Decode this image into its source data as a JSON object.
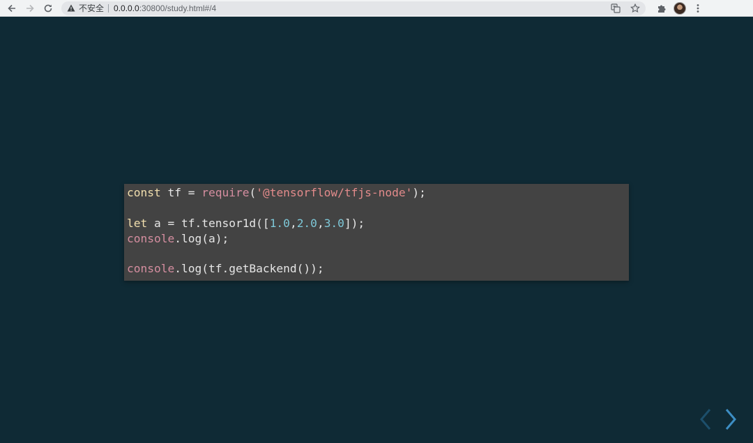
{
  "browser": {
    "insecure_label": "不安全",
    "url_host": "0.0.0.0",
    "url_rest": ":30800/study.html#/4"
  },
  "code": {
    "lines": [
      [
        {
          "t": "const",
          "c": "kw"
        },
        {
          "t": " tf = ",
          "c": "plain"
        },
        {
          "t": "require",
          "c": "builtin"
        },
        {
          "t": "(",
          "c": "plain"
        },
        {
          "t": "'@tensorflow/tfjs-node'",
          "c": "str"
        },
        {
          "t": ");",
          "c": "plain"
        }
      ],
      [],
      [
        {
          "t": "let",
          "c": "kw"
        },
        {
          "t": " a = tf.tensor1d([",
          "c": "plain"
        },
        {
          "t": "1.0",
          "c": "num"
        },
        {
          "t": ",",
          "c": "plain"
        },
        {
          "t": "2.0",
          "c": "num"
        },
        {
          "t": ",",
          "c": "plain"
        },
        {
          "t": "3.0",
          "c": "num"
        },
        {
          "t": "]);",
          "c": "plain"
        }
      ],
      [
        {
          "t": "console",
          "c": "builtin"
        },
        {
          "t": ".log(a);",
          "c": "plain"
        }
      ],
      [],
      [
        {
          "t": "console",
          "c": "builtin"
        },
        {
          "t": ".log(tf.getBackend());",
          "c": "plain"
        }
      ]
    ]
  },
  "colors": {
    "slide_background": "#0f2a35",
    "code_background": "#434343",
    "keyword": "#f2dfae",
    "string": "#e38b8b",
    "number": "#7ec8d8",
    "builtin": "#d58ea0",
    "nav_prev": "#1d4f6b",
    "nav_next": "#3d8ec4"
  },
  "icons": {
    "back": "arrow-left-icon",
    "forward": "arrow-right-icon",
    "reload": "reload-icon",
    "insecure": "warning-triangle-icon",
    "translate": "translate-icon",
    "bookmark": "star-icon",
    "extensions": "puzzle-icon",
    "menu": "kebab-menu-icon",
    "slide_prev": "chevron-left-icon",
    "slide_next": "chevron-right-icon"
  }
}
